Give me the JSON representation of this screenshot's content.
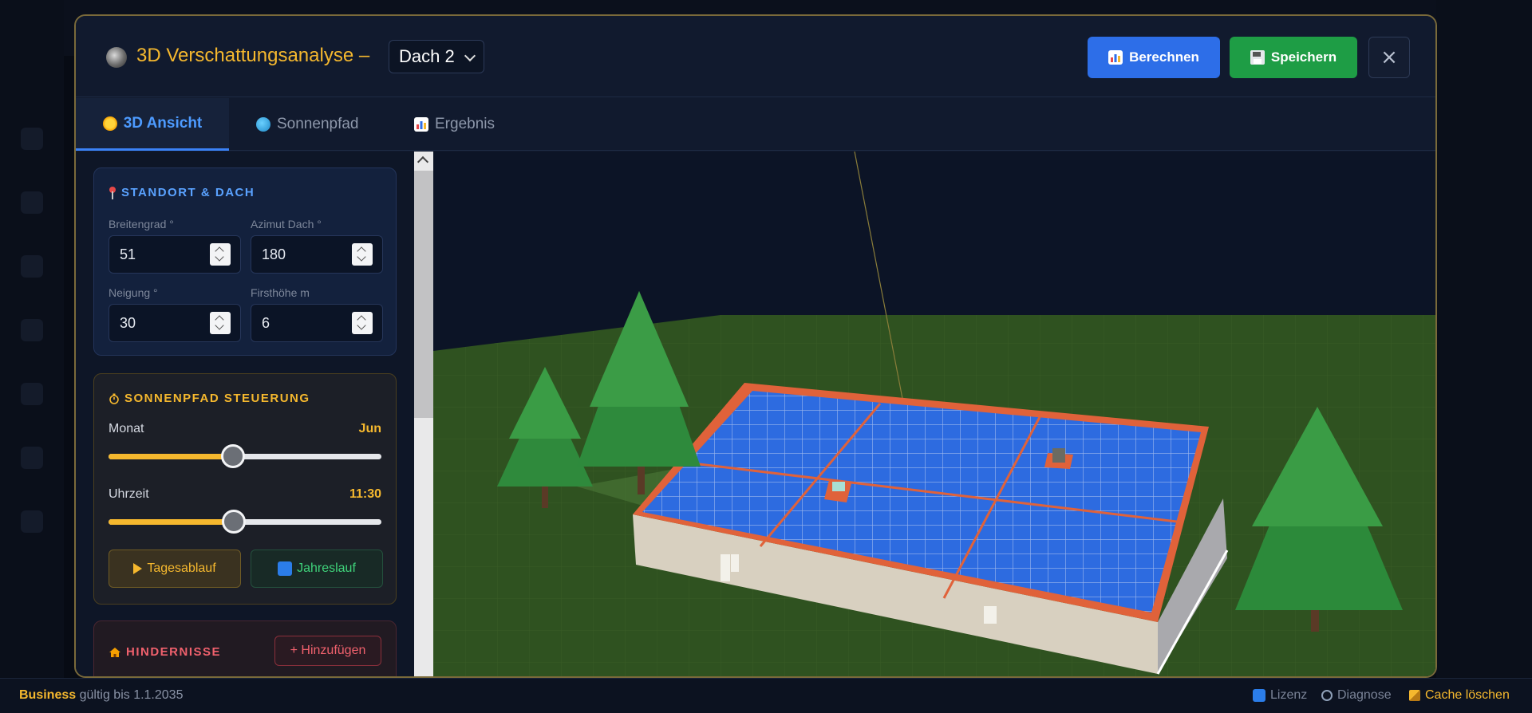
{
  "header": {
    "title": "3D Verschattungsanalyse –",
    "roof_select_value": "Dach 2",
    "calc_label": "Berechnen",
    "save_label": "Speichern",
    "close_symbol": "×"
  },
  "tabs": [
    {
      "label": "3D Ansicht",
      "active": true,
      "icon": "sun-icon"
    },
    {
      "label": "Sonnenpfad",
      "active": false,
      "icon": "globe-icon"
    },
    {
      "label": "Ergebnis",
      "active": false,
      "icon": "bar-chart-icon"
    }
  ],
  "standort": {
    "title": "STANDORT & DACH",
    "fields": [
      {
        "label": "Breitengrad °",
        "value": "51"
      },
      {
        "label": "Azimut Dach °",
        "value": "180"
      },
      {
        "label": "Neigung °",
        "value": "30"
      },
      {
        "label": "Firsthöhe m",
        "value": "6"
      }
    ]
  },
  "sonnenpfad": {
    "title": "SONNENPFAD STEUERUNG",
    "month_label": "Monat",
    "month_value": "Jun",
    "month_fraction": 0.455,
    "time_label": "Uhrzeit",
    "time_value": "11:30",
    "time_fraction": 0.458,
    "day_button": "Tagesablauf",
    "year_button": "Jahreslauf"
  },
  "hindernisse": {
    "title": "HINDERNISSE",
    "add_button": "+ Hinzufügen"
  },
  "statusbar": {
    "plan": "Business",
    "validity": "gültig bis 1.1.2035",
    "license": "Lizenz",
    "diagnose": "Diagnose",
    "cache": "Cache löschen"
  },
  "colors": {
    "accent_gold": "#f5b82e",
    "accent_blue": "#3b82f6",
    "save_green": "#1e9d45",
    "danger_red": "#f0616d"
  }
}
